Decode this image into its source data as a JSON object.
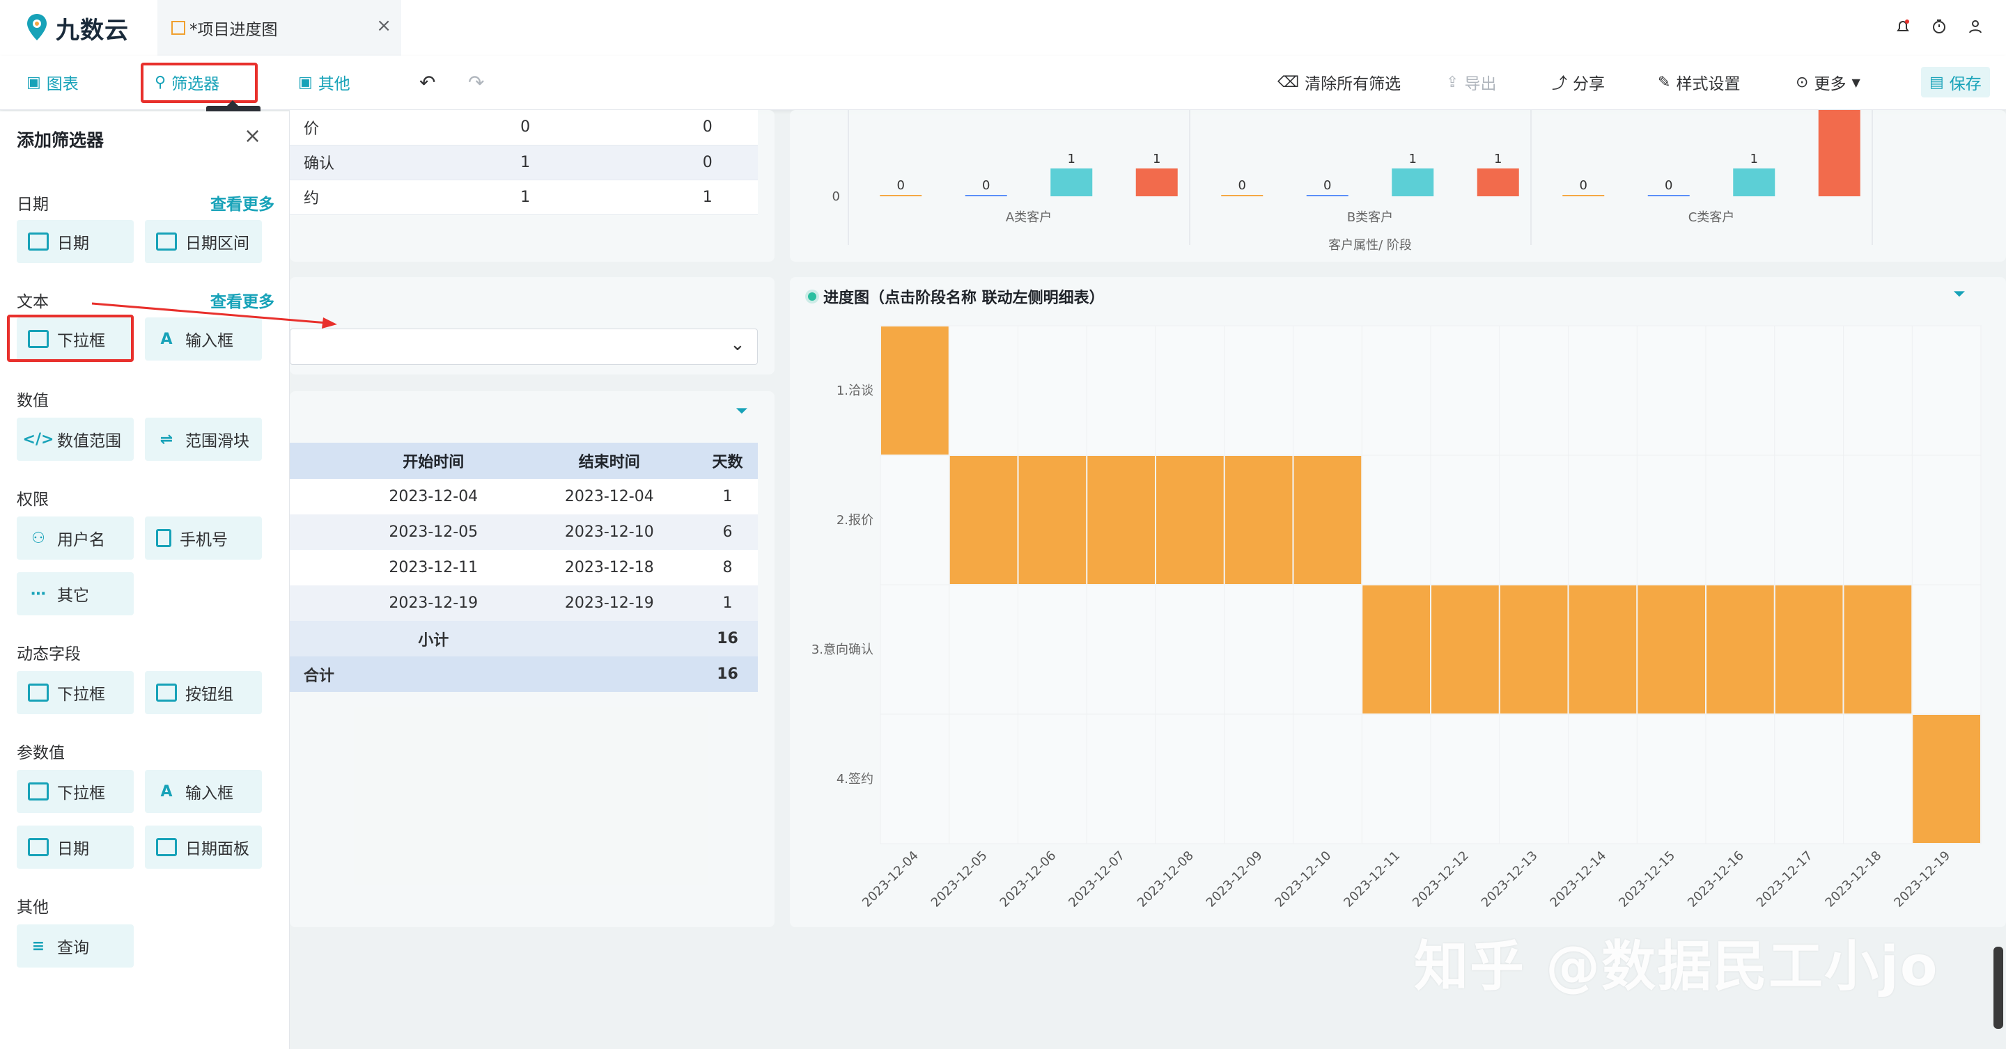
{
  "app": {
    "logo_text": "九数云"
  },
  "tab": {
    "title": "*项目进度图",
    "close": "×"
  },
  "toolbar": {
    "chart": "图表",
    "filter": "筛选器",
    "other": "其他",
    "clear_filters": "清除所有筛选",
    "export": "导出",
    "share": "分享",
    "style": "样式设置",
    "more": "更多",
    "save": "保存",
    "tooltip": "筛选器"
  },
  "panel": {
    "title": "添加筛选器",
    "close": "×",
    "sections": {
      "date": {
        "label": "日期",
        "more": "查看更多",
        "items": [
          "日期",
          "日期区间"
        ]
      },
      "text": {
        "label": "文本",
        "more": "查看更多",
        "items": [
          "下拉框",
          "输入框"
        ]
      },
      "number": {
        "label": "数值",
        "items": [
          "数值范围",
          "范围滑块"
        ]
      },
      "perm": {
        "label": "权限",
        "items": [
          "用户名",
          "手机号",
          "其它"
        ]
      },
      "dynamic": {
        "label": "动态字段",
        "items": [
          "下拉框",
          "按钮组"
        ]
      },
      "param": {
        "label": "参数值",
        "items": [
          "下拉框",
          "输入框",
          "日期",
          "日期面板"
        ]
      },
      "other": {
        "label": "其他",
        "items": [
          "查询"
        ]
      }
    }
  },
  "top_table": {
    "rows": [
      [
        "价",
        "0",
        "0"
      ],
      [
        "确认",
        "1",
        "0"
      ],
      [
        "约",
        "1",
        "1"
      ]
    ]
  },
  "detail_table": {
    "headers": [
      "开始时间",
      "结束时间",
      "天数"
    ],
    "rows": [
      [
        "2023-12-04",
        "2023-12-04",
        "1"
      ],
      [
        "2023-12-05",
        "2023-12-10",
        "6"
      ],
      [
        "2023-12-11",
        "2023-12-18",
        "8"
      ],
      [
        "2023-12-19",
        "2023-12-19",
        "1"
      ]
    ],
    "subtotal_label": "小计",
    "subtotal_value": "16",
    "total_label": "合计",
    "total_value": "16"
  },
  "colors": {
    "accent": "#17a2b8",
    "orange": "#f5a844",
    "bar_teal": "#5ccfd6",
    "bar_red": "#f26b4c",
    "highlight": "#e8302c"
  },
  "chart_data": [
    {
      "type": "bar",
      "xlabel": "客户属性/ 阶段",
      "categories": [
        "A类客户",
        "B类客户",
        "C类客户"
      ],
      "y_zero_label": "0",
      "groups": [
        {
          "category": "A类客户",
          "values": [
            0,
            0,
            1,
            1
          ]
        },
        {
          "category": "B类客户",
          "values": [
            0,
            0,
            1,
            1
          ]
        },
        {
          "category": "C类客户",
          "values": [
            0,
            0,
            1,
            null
          ]
        }
      ]
    },
    {
      "type": "bar",
      "title": "进度图（点击阶段名称 联动左侧明细表）",
      "stages": [
        "1.洽谈",
        "2.报价",
        "3.意向确认",
        "4.签约"
      ],
      "dates": [
        "2023-12-04",
        "2023-12-05",
        "2023-12-06",
        "2023-12-07",
        "2023-12-08",
        "2023-12-09",
        "2023-12-10",
        "2023-12-11",
        "2023-12-12",
        "2023-12-13",
        "2023-12-14",
        "2023-12-15",
        "2023-12-16",
        "2023-12-17",
        "2023-12-18",
        "2023-12-19"
      ],
      "tasks": [
        {
          "stage": "1.洽谈",
          "start": "2023-12-04",
          "end": "2023-12-04"
        },
        {
          "stage": "2.报价",
          "start": "2023-12-05",
          "end": "2023-12-10"
        },
        {
          "stage": "3.意向确认",
          "start": "2023-12-11",
          "end": "2023-12-18"
        },
        {
          "stage": "4.签约",
          "start": "2023-12-19",
          "end": "2023-12-19"
        }
      ]
    }
  ],
  "watermark": "知乎 @数据民工小jo"
}
